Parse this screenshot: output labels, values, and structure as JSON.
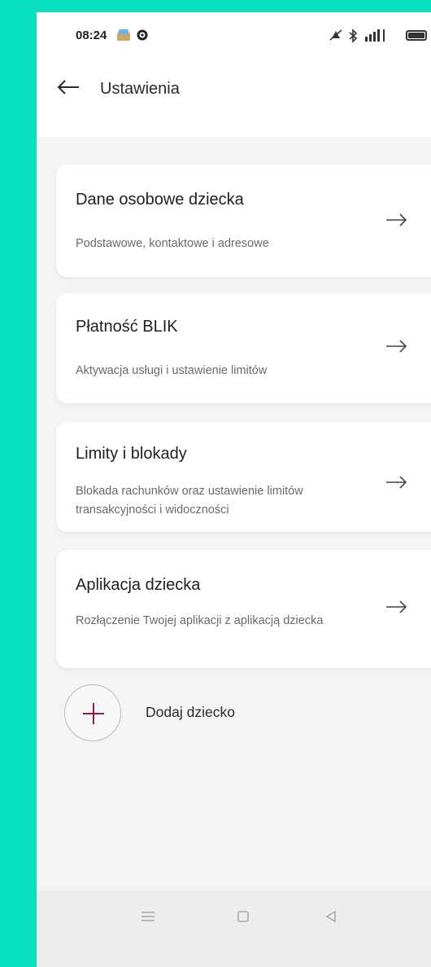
{
  "status_bar": {
    "time": "08:24"
  },
  "header": {
    "title": "Ustawienia"
  },
  "cards": [
    {
      "title": "Dane osobowe dziecka",
      "subtitle": "Podstawowe, kontaktowe i adresowe"
    },
    {
      "title": "Płatność BLIK",
      "subtitle": "Aktywacja usługi i ustawienie limitów"
    },
    {
      "title": "Limity i blokady",
      "subtitle": "Blokada rachunków oraz ustawienie limitów transakcyjności i widoczności"
    },
    {
      "title": "Aplikacja dziecka",
      "subtitle": "Rozłączenie Twojej aplikacji z aplikacją dziecka"
    }
  ],
  "add_child": {
    "label": "Dodaj dziecko"
  },
  "colors": {
    "background": "#08e0bf",
    "accent": "#8a1c4e"
  }
}
